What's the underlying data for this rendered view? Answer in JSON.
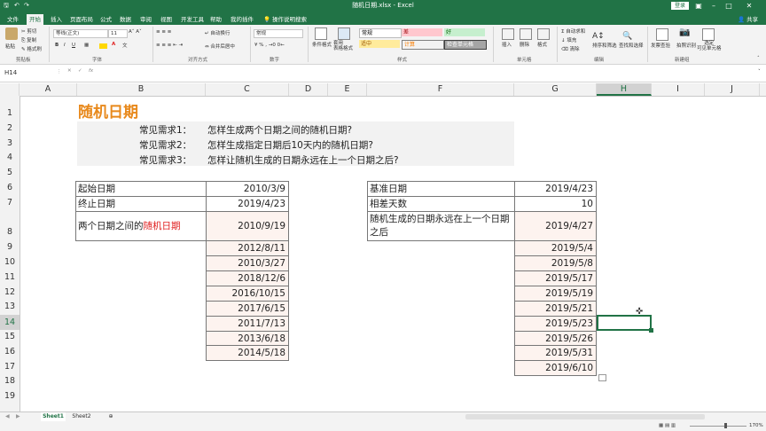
{
  "window": {
    "title": "随机日期.xlsx - Excel",
    "login": "登录",
    "share": "共享"
  },
  "tabs": [
    "文件",
    "开始",
    "插入",
    "页面布局",
    "公式",
    "数据",
    "审阅",
    "视图",
    "开发工具",
    "帮助",
    "我的插件"
  ],
  "tell_me": "操作说明搜索",
  "ribbon": {
    "paste": "粘贴",
    "cut": "剪切",
    "copy": "复制",
    "format_painter": "格式刷",
    "font_name": "等线(正文)",
    "font_size": "11",
    "wrap": "自动换行",
    "merge": "合并后居中",
    "number_format": "常规",
    "cond_format": "条件格式",
    "table_format": "套用\n表格格式",
    "style_normal": "常规",
    "style_bad": "差",
    "style_good": "好",
    "style_neutral": "适中",
    "style_calc": "计算",
    "style_check": "检查单元格",
    "insert": "插入",
    "delete": "删除",
    "format": "格式",
    "autosum": "自动求和",
    "fill": "填充",
    "clear": "清除",
    "sort": "排序和筛选",
    "find": "查找和选择",
    "invoice": "发票查验",
    "photo": "拍照识别",
    "select_visible": "选定\n可见单元格",
    "groups": [
      "剪贴板",
      "字体",
      "对齐方式",
      "数字",
      "样式",
      "单元格",
      "编辑",
      "新建组"
    ]
  },
  "name_box": "H14",
  "columns": [
    "A",
    "B",
    "C",
    "D",
    "E",
    "F",
    "G",
    "H",
    "I",
    "J"
  ],
  "rows": [
    "1",
    "2",
    "3",
    "4",
    "5",
    "6",
    "7",
    "8",
    "9",
    "10",
    "11",
    "12",
    "13",
    "14",
    "15",
    "16",
    "17",
    "18",
    "19"
  ],
  "title": "随机日期",
  "requirements": [
    {
      "label": "常见需求1：",
      "text": "怎样生成两个日期之间的随机日期?"
    },
    {
      "label": "常见需求2：",
      "text": "怎样生成指定日期后10天内的随机日期?"
    },
    {
      "label": "常见需求3：",
      "text": "怎样让随机生成的日期永远在上一个日期之后?"
    }
  ],
  "left_table": {
    "start_label": "起始日期",
    "start_value": "2010/3/9",
    "end_label": "终止日期",
    "end_value": "2019/4/23",
    "between_label": "两个日期之间的",
    "between_highlight": "随机日期",
    "between_value": "2010/9/19",
    "values": [
      "2012/8/11",
      "2010/3/27",
      "2018/12/6",
      "2016/10/15",
      "2017/6/15",
      "2011/7/13",
      "2013/6/18",
      "2014/5/18"
    ]
  },
  "right_table": {
    "base_label": "基准日期",
    "base_value": "2019/4/23",
    "diff_label": "相差天数",
    "diff_value": "10",
    "after_label": "随机生成的日期永远在上一个日期之后",
    "after_value": "2019/4/27",
    "values": [
      "2019/5/4",
      "2019/5/8",
      "2019/5/17",
      "2019/5/19",
      "2019/5/21",
      "2019/5/23",
      "2019/5/26",
      "2019/5/31",
      "2019/6/10"
    ]
  },
  "sheets": [
    "Sheet1",
    "Sheet2"
  ],
  "zoom": "170%",
  "colors": {
    "excel_green": "#217346",
    "title_orange": "#e8891c",
    "highlight_red": "#e02020"
  }
}
